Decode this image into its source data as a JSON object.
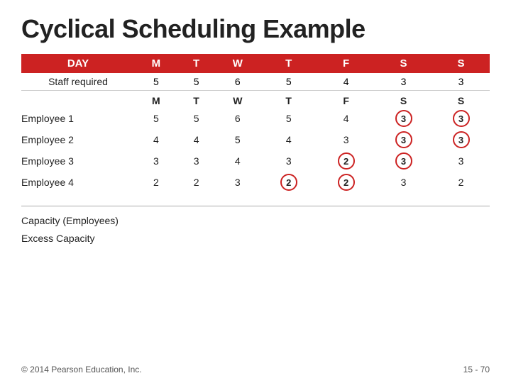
{
  "title": "Cyclical Scheduling Example",
  "table": {
    "header": {
      "day_label": "DAY",
      "cols": [
        "M",
        "T",
        "W",
        "T",
        "F",
        "S",
        "S"
      ]
    },
    "staff_row": {
      "label": "Staff required",
      "values": [
        "5",
        "5",
        "6",
        "5",
        "4",
        "3",
        "3"
      ]
    },
    "sub_header": {
      "cols": [
        "M",
        "T",
        "W",
        "T",
        "F",
        "S",
        "S"
      ]
    },
    "employees": [
      {
        "name": "Employee 1",
        "values": [
          "5",
          "5",
          "6",
          "5",
          "4",
          "3",
          "3"
        ],
        "circled": [
          5,
          6
        ]
      },
      {
        "name": "Employee 2",
        "values": [
          "4",
          "4",
          "5",
          "4",
          "3",
          "3",
          "3"
        ],
        "circled": [
          5,
          6
        ]
      },
      {
        "name": "Employee 3",
        "values": [
          "3",
          "3",
          "4",
          "3",
          "2",
          "3",
          "3"
        ],
        "circled": [
          4,
          5
        ]
      },
      {
        "name": "Employee 4",
        "values": [
          "2",
          "2",
          "3",
          "2",
          "2",
          "3",
          "2"
        ],
        "circled": [
          3,
          4
        ]
      }
    ]
  },
  "bottom": {
    "capacity_label": "Capacity (Employees)",
    "excess_label": "Excess Capacity"
  },
  "footer": {
    "copyright": "© 2014 Pearson Education, Inc.",
    "page": "15 - 70"
  }
}
